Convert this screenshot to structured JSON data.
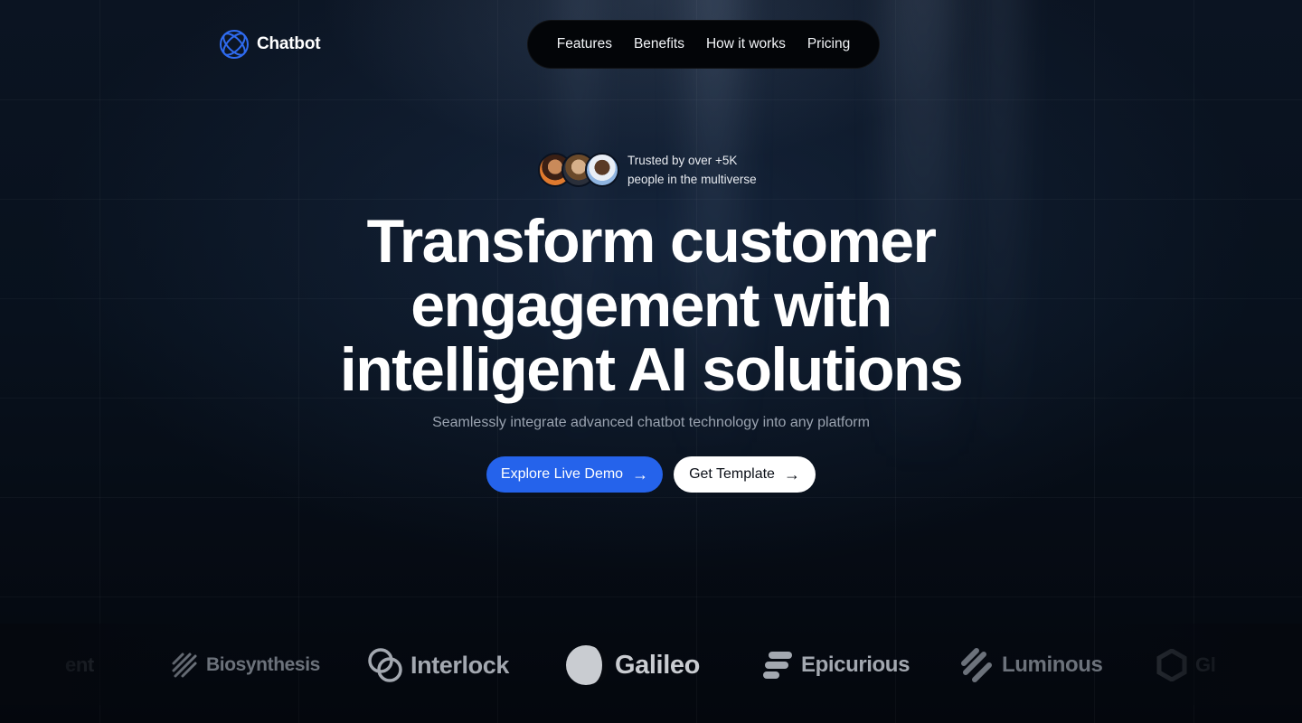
{
  "header": {
    "logo_text": "Chatbot",
    "accent_color": "#2563eb",
    "nav": [
      "Features",
      "Benefits",
      "How it works",
      "Pricing"
    ]
  },
  "trust": {
    "line1": "Trusted by over +5K",
    "line2": "people in the multiverse"
  },
  "hero": {
    "headline": [
      "Transform customer",
      "engagement with",
      "intelligent AI solutions"
    ],
    "subheadline": "Seamlessly integrate advanced chatbot technology into any platform"
  },
  "buttons": {
    "primary": "Explore Live Demo",
    "secondary": "Get Template"
  },
  "logos": {
    "partial_left": "ent",
    "brands": [
      "Biosynthesis",
      "Interlock",
      "Galileo",
      "Epicurious",
      "Luminous"
    ],
    "partial_right": "Gl"
  }
}
